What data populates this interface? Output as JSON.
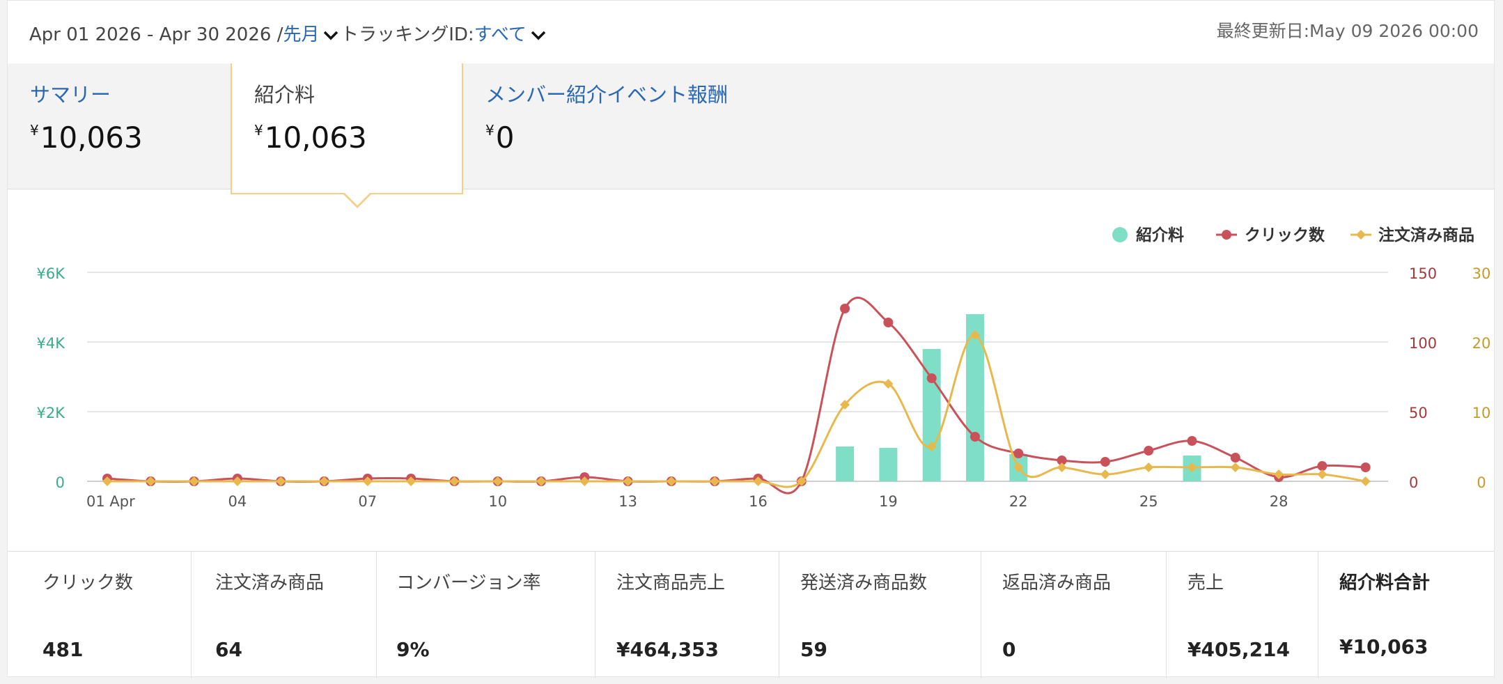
{
  "header": {
    "date_range": "Apr 01 2026 - Apr 30 2026 /",
    "period_link": "先月",
    "tracking_label": "トラッキングID:",
    "tracking_value": "すべて",
    "last_updated": "最終更新日:May 09 2026 00:00"
  },
  "tabs": [
    {
      "label": "サマリー",
      "yen": "¥",
      "value": "10,063"
    },
    {
      "label": "紹介料",
      "yen": "¥",
      "value": "10,063"
    },
    {
      "label": "メンバー紹介イベント報酬",
      "yen": "¥",
      "value": "0"
    }
  ],
  "colors": {
    "fee": "#7fdfc6",
    "clicks": "#c9525a",
    "orders": "#e8b84c",
    "link": "#2a68b4",
    "left_axis": "#3aab86",
    "right_axis_clicks": "#a33a3a",
    "right_axis_orders": "#c59a2a"
  },
  "chart_data": {
    "type": "bar",
    "legend_placement": "top-right",
    "grid": true,
    "x": [
      1,
      2,
      3,
      4,
      5,
      6,
      7,
      8,
      9,
      10,
      11,
      12,
      13,
      14,
      15,
      16,
      17,
      18,
      19,
      20,
      21,
      22,
      23,
      24,
      25,
      26,
      27,
      28,
      29,
      30
    ],
    "x_tick_labels": [
      "01 Apr",
      "04",
      "07",
      "10",
      "13",
      "16",
      "19",
      "22",
      "25",
      "28"
    ],
    "x_tick_positions": [
      1,
      4,
      7,
      10,
      13,
      16,
      19,
      22,
      25,
      28
    ],
    "y_left": {
      "ticks": [
        "0",
        "¥2K",
        "¥4K",
        "¥6K"
      ],
      "range": [
        0,
        6000
      ]
    },
    "y_right_clicks": {
      "ticks": [
        "0",
        "50",
        "100",
        "150"
      ],
      "range": [
        0,
        150
      ]
    },
    "y_right_orders": {
      "ticks": [
        "0",
        "10",
        "20",
        "30"
      ],
      "range": [
        0,
        30
      ]
    },
    "series": [
      {
        "name": "紹介料",
        "kind": "bar",
        "axis": "left",
        "values": [
          0,
          0,
          0,
          0,
          0,
          0,
          0,
          0,
          0,
          0,
          0,
          0,
          0,
          0,
          0,
          0,
          0,
          1000,
          960,
          3800,
          4800,
          780,
          0,
          0,
          0,
          740,
          0,
          0,
          0,
          0
        ]
      },
      {
        "name": "クリック数",
        "kind": "line",
        "axis": "clicks",
        "values": [
          2,
          0,
          0,
          2,
          0,
          0,
          2,
          2,
          0,
          0,
          0,
          3,
          0,
          0,
          0,
          2,
          0,
          124,
          114,
          74,
          32,
          20,
          15,
          14,
          22,
          29,
          17,
          3,
          11,
          10
        ]
      },
      {
        "name": "注文済み商品",
        "kind": "line",
        "axis": "orders",
        "values": [
          0,
          0,
          0,
          0,
          0,
          0,
          0,
          0,
          0,
          0,
          0,
          0,
          0,
          0,
          0,
          0,
          0,
          11,
          14,
          5,
          21,
          2,
          2,
          1,
          2,
          2,
          2,
          1,
          1,
          0
        ]
      }
    ]
  },
  "stats": [
    {
      "label": "クリック数",
      "value": "481"
    },
    {
      "label": "注文済み商品",
      "value": "64"
    },
    {
      "label": "コンバージョン率",
      "value": "9%"
    },
    {
      "label": "注文商品売上",
      "value": "¥464,353"
    },
    {
      "label": "発送済み商品数",
      "value": "59"
    },
    {
      "label": "返品済み商品",
      "value": "0"
    },
    {
      "label": "売上",
      "value": "¥405,214"
    },
    {
      "label": "紹介料合計",
      "value": "¥10,063"
    }
  ]
}
